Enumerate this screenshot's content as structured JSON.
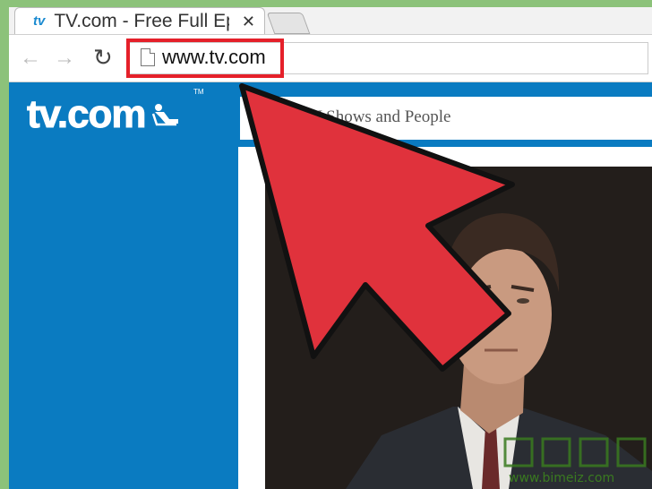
{
  "browser": {
    "tab": {
      "favicon": "tv",
      "title": "TV.com - Free Full Ep",
      "close": "✕"
    },
    "nav": {
      "back": "←",
      "forward": "→",
      "reload": "↻"
    },
    "address_bar": {
      "url": "www.tv.com"
    }
  },
  "site": {
    "logo_text": "tv.com",
    "logo_tm": "TM",
    "search_text": "V Shows and People"
  },
  "watermark": {
    "text": "www.bimeiz.com",
    "chars": "生活百科"
  },
  "colors": {
    "brand_blue": "#0a7bc1",
    "highlight_red": "#e5202a",
    "arrow_red": "#e8323f"
  }
}
